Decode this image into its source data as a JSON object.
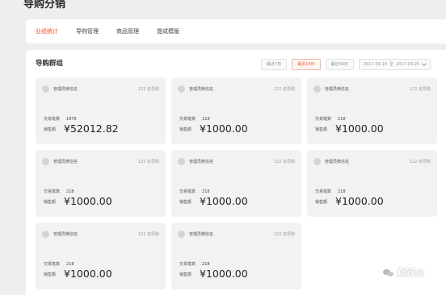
{
  "page": {
    "title": "导购分销"
  },
  "tabs": [
    {
      "label": "业绩统计",
      "active": true
    },
    {
      "label": "导购管理",
      "active": false
    },
    {
      "label": "商品管理",
      "active": false
    },
    {
      "label": "提成模版",
      "active": false
    }
  ],
  "section": {
    "title": "导购群组"
  },
  "filters": {
    "buttons": [
      {
        "label": "最近7日",
        "active": false
      },
      {
        "label": "最近15日",
        "active": true
      },
      {
        "label": "最近30日",
        "active": false
      }
    ],
    "date_start": "2017-09-18",
    "date_sep": "至",
    "date_end": "2017-09-25"
  },
  "cards": [
    {
      "manager": "管理员微信名",
      "members": "122 名导购",
      "trade_label": "交易笔数",
      "trade_count": "1876",
      "sales_label": "销售额",
      "sales": "¥52012.82"
    },
    {
      "manager": "管理员微信名",
      "members": "122 名导购",
      "trade_label": "交易笔数",
      "trade_count": "218",
      "sales_label": "销售额",
      "sales": "¥1000.00"
    },
    {
      "manager": "管理员微信名",
      "members": "122 名导购",
      "trade_label": "交易笔数",
      "trade_count": "218",
      "sales_label": "销售额",
      "sales": "¥1000.00"
    },
    {
      "manager": "管理员微信名",
      "members": "122 名导购",
      "trade_label": "交易笔数",
      "trade_count": "218",
      "sales_label": "销售额",
      "sales": "¥1000.00"
    },
    {
      "manager": "管理员微信名",
      "members": "122 名导购",
      "trade_label": "交易笔数",
      "trade_count": "218",
      "sales_label": "销售额",
      "sales": "¥1000.00"
    },
    {
      "manager": "管理员微信名",
      "members": "122 名导购",
      "trade_label": "交易笔数",
      "trade_count": "218",
      "sales_label": "销售额",
      "sales": "¥1000.00"
    },
    {
      "manager": "管理员微信名",
      "members": "122 名导购",
      "trade_label": "交易笔数",
      "trade_count": "218",
      "sales_label": "销售额",
      "sales": "¥1000.00"
    },
    {
      "manager": "管理员微信名",
      "members": "122 名导购",
      "trade_label": "交易笔数",
      "trade_count": "218",
      "sales_label": "销售额",
      "sales": "¥1000.00"
    }
  ],
  "watermark": {
    "text": "翔跃火"
  },
  "colors": {
    "accent": "#e8552a",
    "card_bg": "#f2f2f2",
    "page_bg": "#eeeeee"
  }
}
